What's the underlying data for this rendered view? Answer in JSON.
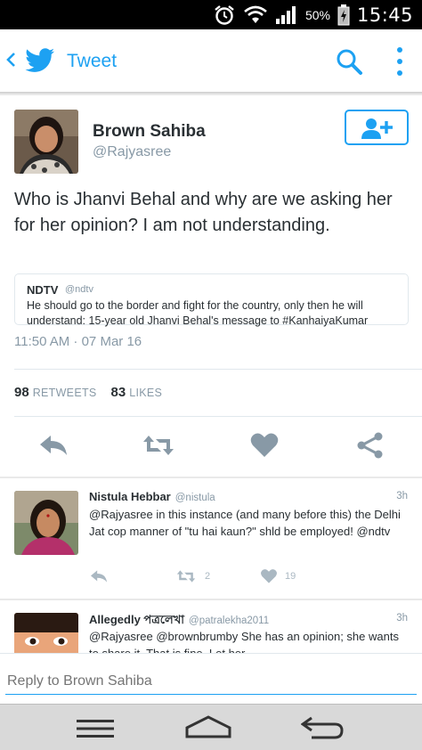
{
  "status_bar": {
    "battery_percent": "50%",
    "time": "15:45"
  },
  "header": {
    "title": "Tweet"
  },
  "tweet": {
    "author_name": "Brown Sahiba",
    "author_handle": "@Rajyasree",
    "text": "Who is Jhanvi Behal and why are we asking her for her opinion? I am not understanding.",
    "quote": {
      "name": "NDTV",
      "handle": "@ndtv",
      "text": "He should go to the border and fight for the country, only then he will understand: 15-year old Jhanvi Behal's message to #KanhaiyaKumar"
    },
    "timestamp": "11:50 AM · 07 Mar 16",
    "retweets_count": "98",
    "retweets_label": "RETWEETS",
    "likes_count": "83",
    "likes_label": "LIKES"
  },
  "replies": [
    {
      "name": "Nistula Hebbar",
      "handle": "@nistula",
      "time": "3h",
      "text": "@Rajyasree in this instance (and many before this) the Delhi Jat cop manner of \"tu hai kaun?\" shld be employed! @ndtv",
      "retweets": "2",
      "likes": "19"
    },
    {
      "name": "Allegedly পত্রলেখা",
      "handle": "@patralekha2011",
      "time": "3h",
      "text": "@Rajyasree @brownbrumby She has an opinion; she wants to share it. That is fine. Let her"
    }
  ],
  "reply_box": {
    "placeholder": "Reply to Brown Sahiba"
  },
  "colors": {
    "twitter_blue": "#1da1f2",
    "secondary_text": "#8899a6",
    "action_gray": "#8899a6"
  }
}
